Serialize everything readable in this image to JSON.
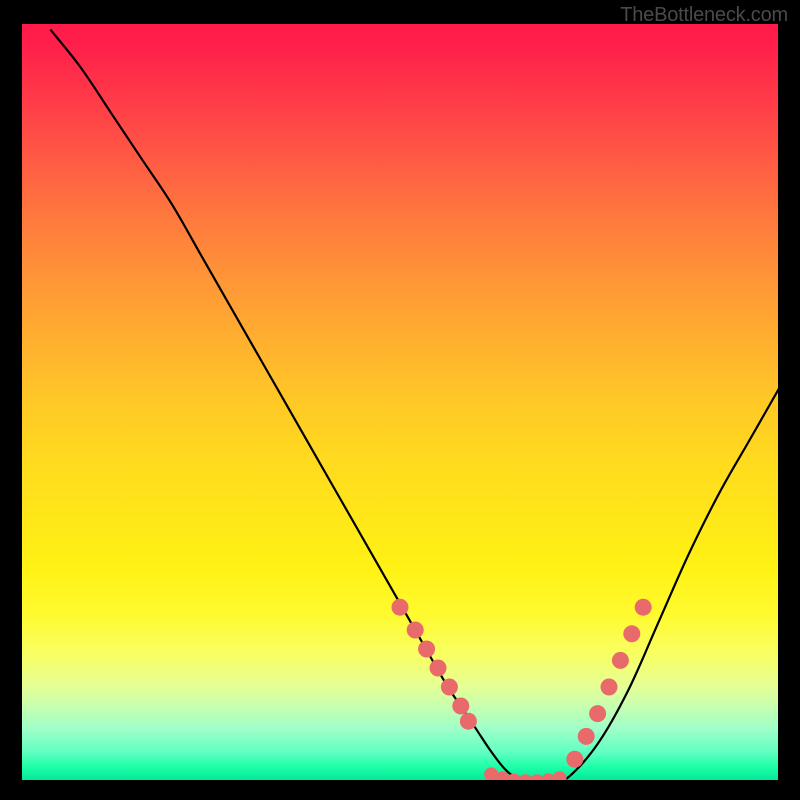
{
  "watermark": "TheBottleneck.com",
  "chart_data": {
    "type": "line",
    "title": "",
    "xlabel": "",
    "ylabel": "",
    "xlim": [
      0,
      100
    ],
    "ylim": [
      0,
      100
    ],
    "grid": false,
    "legend": false,
    "background": "rainbow-gradient",
    "series": [
      {
        "name": "bottleneck-curve",
        "x": [
          4,
          8,
          12,
          16,
          20,
          24,
          28,
          32,
          36,
          40,
          44,
          48,
          52,
          56,
          58,
          60,
          62,
          64,
          66,
          68,
          70,
          72,
          76,
          80,
          84,
          88,
          92,
          96,
          100
        ],
        "y": [
          99,
          94,
          88,
          82,
          76,
          69,
          62,
          55,
          48,
          41,
          34,
          27,
          20,
          13,
          10,
          7,
          4,
          1.5,
          0.2,
          0,
          0,
          0.5,
          5,
          12,
          21,
          30,
          38,
          45,
          52
        ]
      }
    ],
    "markers": {
      "left_slope": [
        {
          "x": 50,
          "y": 23
        },
        {
          "x": 52,
          "y": 20
        },
        {
          "x": 53.5,
          "y": 17.5
        },
        {
          "x": 55,
          "y": 15
        },
        {
          "x": 56.5,
          "y": 12.5
        },
        {
          "x": 58,
          "y": 10
        },
        {
          "x": 59,
          "y": 8
        }
      ],
      "plateau": [
        {
          "x": 62,
          "y": 1
        },
        {
          "x": 63.5,
          "y": 0.5
        },
        {
          "x": 65,
          "y": 0.2
        },
        {
          "x": 66.5,
          "y": 0.1
        },
        {
          "x": 68,
          "y": 0.1
        },
        {
          "x": 69.5,
          "y": 0.2
        },
        {
          "x": 71,
          "y": 0.5
        }
      ],
      "right_slope": [
        {
          "x": 73,
          "y": 3
        },
        {
          "x": 74.5,
          "y": 6
        },
        {
          "x": 76,
          "y": 9
        },
        {
          "x": 77.5,
          "y": 12.5
        },
        {
          "x": 79,
          "y": 16
        },
        {
          "x": 80.5,
          "y": 19.5
        },
        {
          "x": 82,
          "y": 23
        }
      ]
    }
  }
}
